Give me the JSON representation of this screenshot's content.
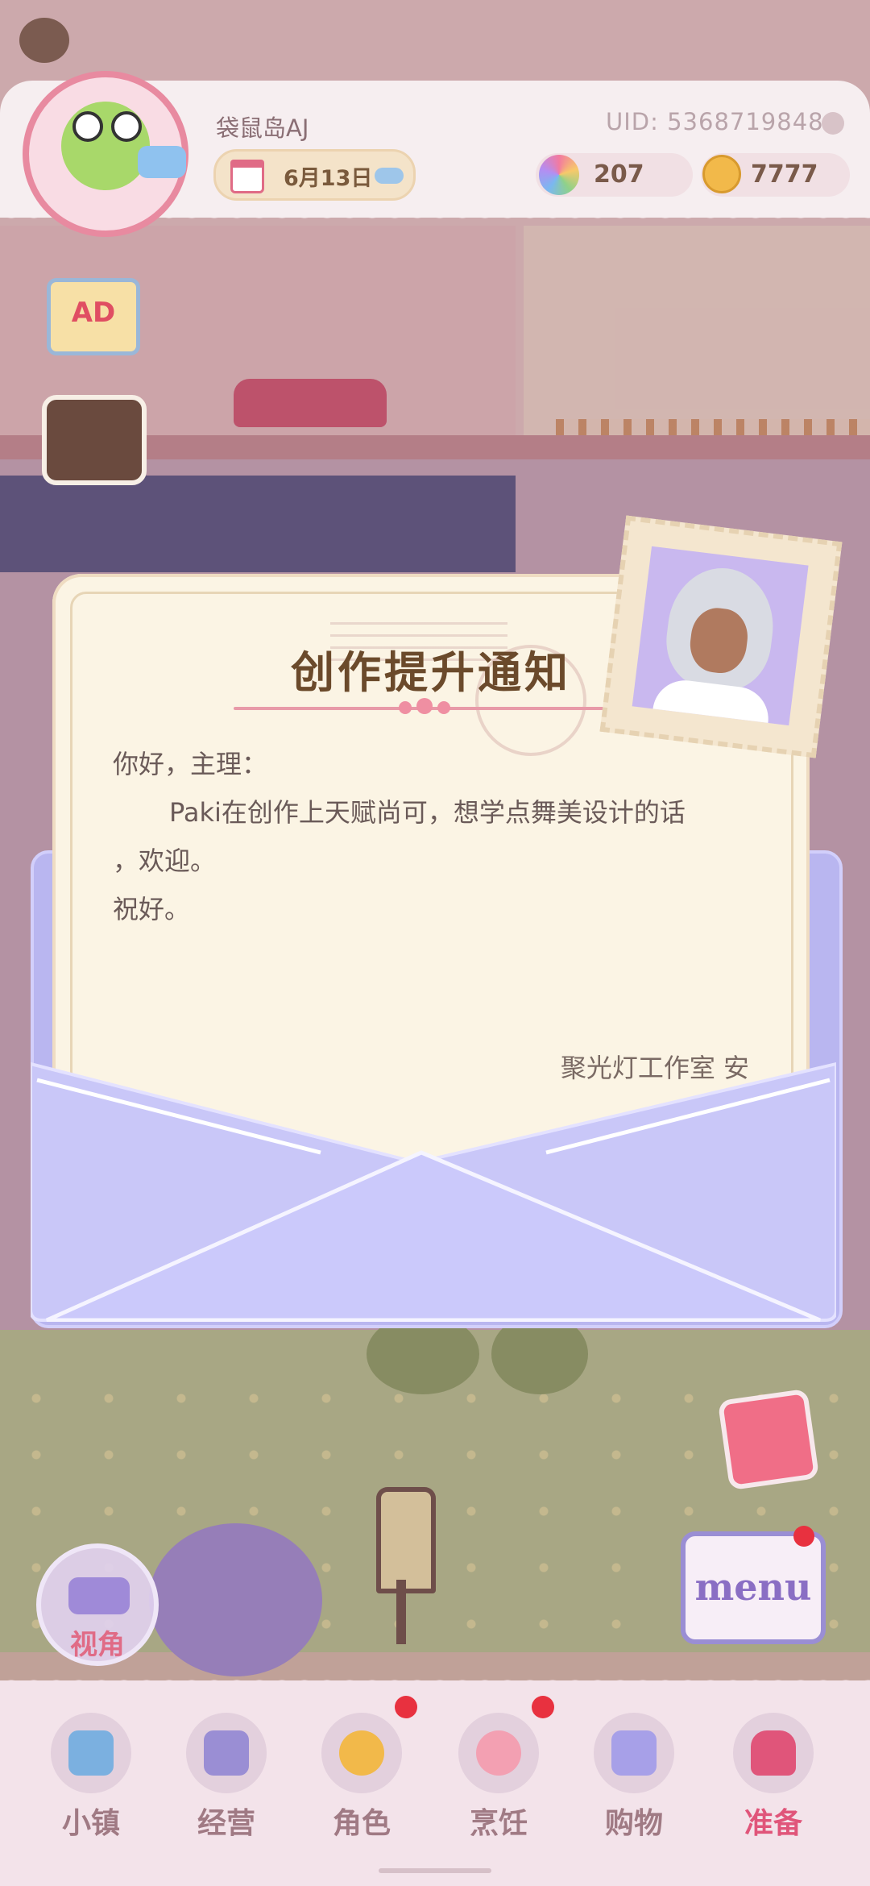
{
  "header": {
    "player_name": "袋鼠岛AJ",
    "date": "6月13日",
    "weather_icon": "cloud-icon",
    "uid": "UID: 5368719848",
    "gems": "207",
    "coins": "7777"
  },
  "side_buttons": {
    "ad_label": "AD"
  },
  "letter": {
    "title": "创作提升通知",
    "greeting": "你好，主理：",
    "body_line1": "Paki在创作上天赋尚可，想学点舞美设计的话",
    "body_line2": "，欢迎。",
    "closing": "祝好。",
    "signature": "聚光灯工作室   安"
  },
  "camera": {
    "label": "视角"
  },
  "menu": {
    "label": "menu"
  },
  "nav": [
    {
      "label": "小镇",
      "icon": "map-icon",
      "color": "#7bb0e0"
    },
    {
      "label": "经营",
      "icon": "bag-lock-icon",
      "color": "#9a8ed4"
    },
    {
      "label": "角色",
      "icon": "character-icon",
      "color": "#f2b94a"
    },
    {
      "label": "烹饪",
      "icon": "cake-icon",
      "color": "#f3a0b2"
    },
    {
      "label": "购物",
      "icon": "shopping-bag-icon",
      "color": "#a7a0e8"
    },
    {
      "label": "准备",
      "icon": "basket-icon",
      "color": "#e0557a"
    }
  ],
  "colors": {
    "accent_pink": "#e0557a",
    "envelope": "#b9b6f0",
    "letter_paper": "#fbf4e4",
    "title_brown": "#6b4a2b"
  }
}
